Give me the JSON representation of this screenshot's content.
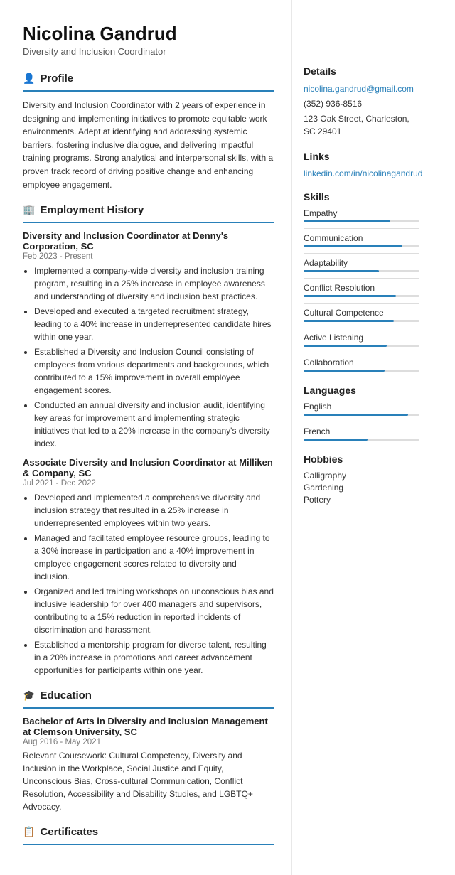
{
  "header": {
    "name": "Nicolina Gandrud",
    "job_title": "Diversity and Inclusion Coordinator"
  },
  "profile": {
    "section_label": "Profile",
    "icon": "👤",
    "text": "Diversity and Inclusion Coordinator with 2 years of experience in designing and implementing initiatives to promote equitable work environments. Adept at identifying and addressing systemic barriers, fostering inclusive dialogue, and delivering impactful training programs. Strong analytical and interpersonal skills, with a proven track record of driving positive change and enhancing employee engagement."
  },
  "employment": {
    "section_label": "Employment History",
    "icon": "🏢",
    "jobs": [
      {
        "title": "Diversity and Inclusion Coordinator at Denny's Corporation, SC",
        "date": "Feb 2023 - Present",
        "bullets": [
          "Implemented a company-wide diversity and inclusion training program, resulting in a 25% increase in employee awareness and understanding of diversity and inclusion best practices.",
          "Developed and executed a targeted recruitment strategy, leading to a 40% increase in underrepresented candidate hires within one year.",
          "Established a Diversity and Inclusion Council consisting of employees from various departments and backgrounds, which contributed to a 15% improvement in overall employee engagement scores.",
          "Conducted an annual diversity and inclusion audit, identifying key areas for improvement and implementing strategic initiatives that led to a 20% increase in the company's diversity index."
        ]
      },
      {
        "title": "Associate Diversity and Inclusion Coordinator at Milliken & Company, SC",
        "date": "Jul 2021 - Dec 2022",
        "bullets": [
          "Developed and implemented a comprehensive diversity and inclusion strategy that resulted in a 25% increase in underrepresented employees within two years.",
          "Managed and facilitated employee resource groups, leading to a 30% increase in participation and a 40% improvement in employee engagement scores related to diversity and inclusion.",
          "Organized and led training workshops on unconscious bias and inclusive leadership for over 400 managers and supervisors, contributing to a 15% reduction in reported incidents of discrimination and harassment.",
          "Established a mentorship program for diverse talent, resulting in a 20% increase in promotions and career advancement opportunities for participants within one year."
        ]
      }
    ]
  },
  "education": {
    "section_label": "Education",
    "icon": "🎓",
    "entries": [
      {
        "degree": "Bachelor of Arts in Diversity and Inclusion Management at Clemson University, SC",
        "date": "Aug 2016 - May 2021",
        "text": "Relevant Coursework: Cultural Competency, Diversity and Inclusion in the Workplace, Social Justice and Equity, Unconscious Bias, Cross-cultural Communication, Conflict Resolution, Accessibility and Disability Studies, and LGBTQ+ Advocacy."
      }
    ]
  },
  "certificates": {
    "section_label": "Certificates",
    "icon": "📋"
  },
  "sidebar": {
    "details": {
      "section_label": "Details",
      "email": "nicolina.gandrud@gmail.com",
      "phone": "(352) 936-8516",
      "address": "123 Oak Street, Charleston, SC 29401"
    },
    "links": {
      "section_label": "Links",
      "linkedin": "linkedin.com/in/nicolinagandrud"
    },
    "skills": {
      "section_label": "Skills",
      "items": [
        {
          "label": "Empathy",
          "pct": 75
        },
        {
          "label": "Communication",
          "pct": 85
        },
        {
          "label": "Adaptability",
          "pct": 65
        },
        {
          "label": "Conflict Resolution",
          "pct": 80
        },
        {
          "label": "Cultural Competence",
          "pct": 78
        },
        {
          "label": "Active Listening",
          "pct": 72
        },
        {
          "label": "Collaboration",
          "pct": 70
        }
      ]
    },
    "languages": {
      "section_label": "Languages",
      "items": [
        {
          "label": "English",
          "pct": 90
        },
        {
          "label": "French",
          "pct": 55
        }
      ]
    },
    "hobbies": {
      "section_label": "Hobbies",
      "items": [
        "Calligraphy",
        "Gardening",
        "Pottery"
      ]
    }
  }
}
